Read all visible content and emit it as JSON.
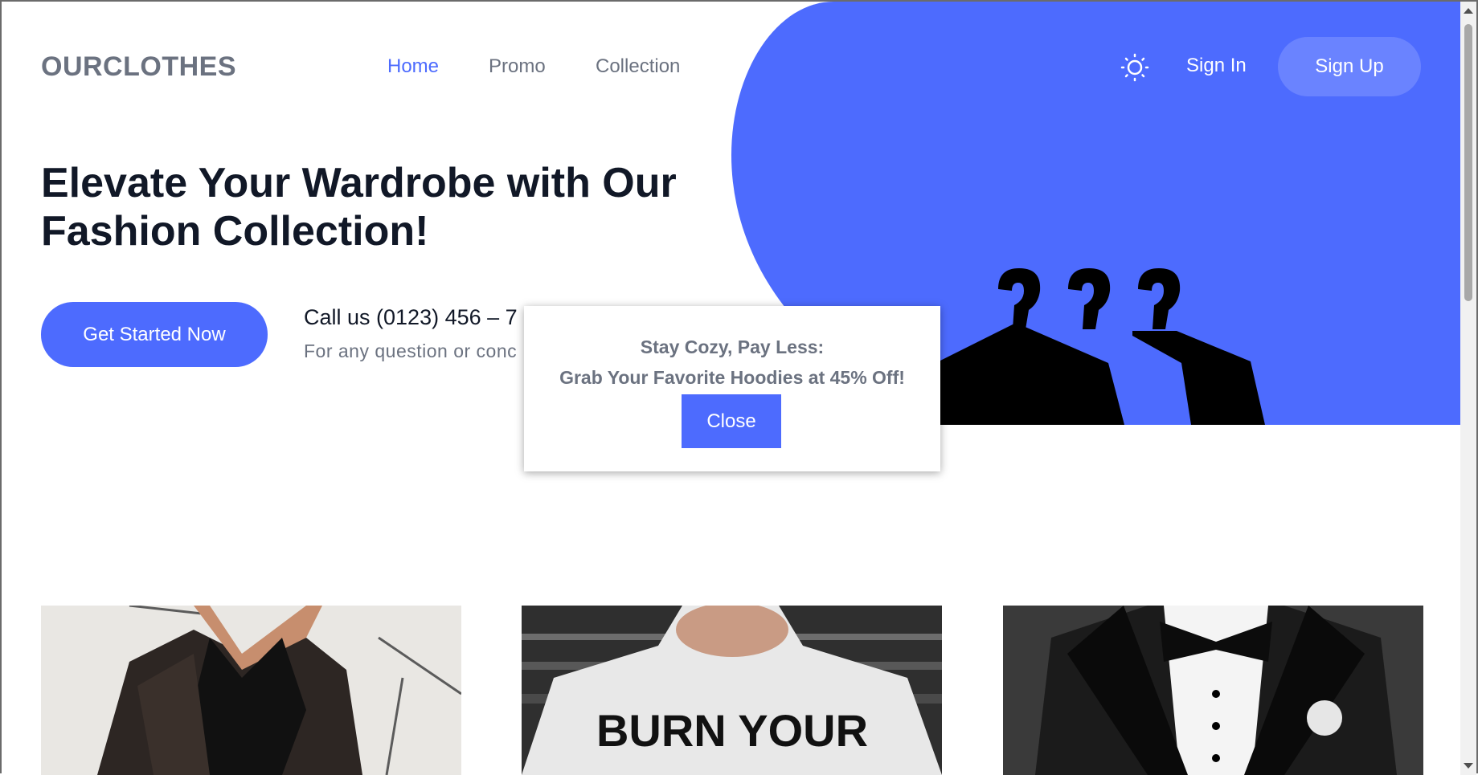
{
  "brand": {
    "logo": "OURCLOTHES"
  },
  "nav": {
    "items": [
      {
        "label": "Home",
        "active": true
      },
      {
        "label": "Promo",
        "active": false
      },
      {
        "label": "Collection",
        "active": false
      }
    ]
  },
  "header": {
    "theme_icon": "sun-icon",
    "sign_in": "Sign In",
    "sign_up": "Sign Up"
  },
  "hero": {
    "headline": "Elevate Your Wardrobe with Our Fashion Collection!",
    "cta": "Get Started Now",
    "call_line": "Call us (0123) 456 – 7",
    "call_sub": "For any question or conc"
  },
  "popup": {
    "line1": "Stay Cozy, Pay Less:",
    "line2": "Grab Your Favorite Hoodies at 45% Off!",
    "close": "Close"
  },
  "cards": [
    {
      "image": "leather-jacket-photo"
    },
    {
      "image": "burn-your-tshirt-photo",
      "print": "BURN YOUR"
    },
    {
      "image": "tuxedo-photo"
    }
  ],
  "colors": {
    "accent": "#4d6bfe",
    "accent_light": "#6a83ff",
    "text": "#111827",
    "muted": "#6b7280"
  }
}
